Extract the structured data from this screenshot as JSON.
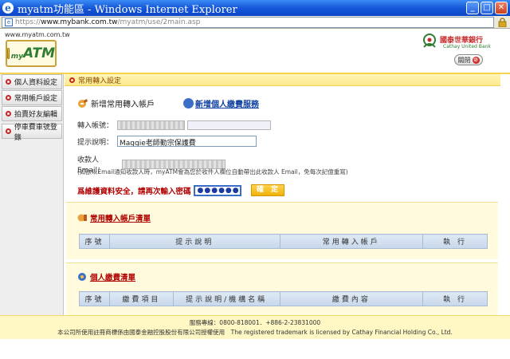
{
  "window": {
    "title": "myatm功能區 - Windows Internet Explorer",
    "url_prefix": "https://",
    "url_host": "www.mybank.com.tw",
    "url_path": "/myatm/use/2main.asp"
  },
  "header": {
    "site_url": "www.myatm.com.tw",
    "logo_my": "my",
    "logo_atm": "ATM",
    "bank_name": "國泰世華銀行",
    "bank_en": "Cathay United Bank",
    "logout_label": "關閉"
  },
  "sidebar": {
    "items": [
      {
        "label": "個人資料設定"
      },
      {
        "label": "常用帳戶設定"
      },
      {
        "label": "拍賣好友編輯"
      },
      {
        "label": "停車費車號登錄"
      }
    ]
  },
  "main": {
    "section_title": "常用轉入設定",
    "add_account_label": "新增常用轉入帳戶",
    "add_service_label": "新增個人繳費服務",
    "form": {
      "account_label": "轉入帳號：",
      "desc_label": "提示說明：",
      "desc_value": "Maggie老師勤宗保護費",
      "email_label": "收款人Email：",
      "note": "(如欲以Email通知收款人時，myATM會為您於收件人欄位自動帶出此收款人 Email，免每次記億重寫)",
      "pwd_label": "爲維護資料安全，請再次輸入密碼",
      "pwd_value": "●●●●●●",
      "confirm_label": "確　定"
    },
    "accounts_panel": {
      "title": "常用轉入帳戶清單",
      "headers": [
        "序號",
        "提示說明",
        "常用轉入帳戶",
        "執 行"
      ]
    },
    "payments_panel": {
      "title": "個人繳費清單",
      "headers": [
        "序號",
        "繳費項目",
        "提示說明/機構名稱",
        "繳費內容",
        "執 行"
      ]
    }
  },
  "footer": {
    "phone": "服務專線：0800-818001．+886-2-23831000",
    "copyright": "本公司所使用註冊商標係由國泰金融控股股份有限公司授權使用　The registered trademark is licensed by Cathay Financial Holding Co., Ltd."
  },
  "colors": {
    "accent_yellow": "#fde98a",
    "warning_red": "#b00000",
    "link_blue": "#1040a0"
  }
}
